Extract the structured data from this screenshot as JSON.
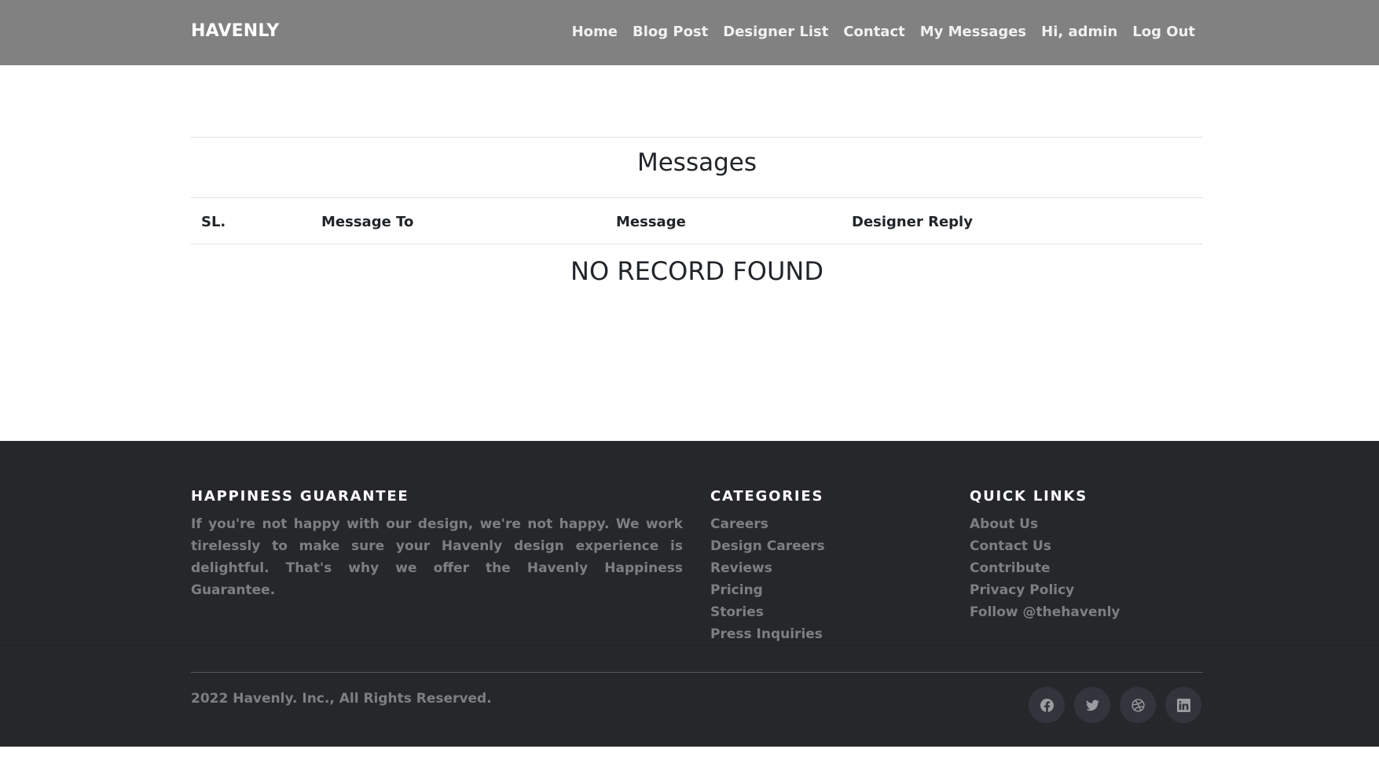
{
  "header": {
    "brand": "HAVENLY",
    "nav": [
      {
        "label": "Home"
      },
      {
        "label": "Blog Post"
      },
      {
        "label": "Designer List"
      },
      {
        "label": "Contact"
      },
      {
        "label": "My Messages"
      },
      {
        "label": "Hi, admin"
      },
      {
        "label": "Log Out"
      }
    ]
  },
  "main": {
    "title": "Messages",
    "columns": [
      "SL.",
      "Message To",
      "Message",
      "Designer Reply"
    ],
    "empty_text": "NO RECORD FOUND"
  },
  "footer": {
    "about": {
      "heading": "HAPPINESS GUARANTEE",
      "text": "If you're not happy with our design, we're not happy. We work tirelessly to make sure your Havenly design experience is delightful. That's why we offer the Havenly Happiness Guarantee."
    },
    "categories": {
      "heading": "CATEGORIES",
      "items": [
        "Careers",
        "Design Careers",
        "Reviews",
        "Pricing",
        "Stories",
        "Press Inquiries"
      ]
    },
    "quick_links": {
      "heading": "QUICK LINKS",
      "items": [
        "About Us",
        "Contact Us",
        "Contribute",
        "Privacy Policy",
        "Follow @thehavenly"
      ]
    },
    "copyright": "2022 Havenly. Inc., All Rights Reserved.",
    "social": [
      "facebook-icon",
      "twitter-icon",
      "dribbble-icon",
      "linkedin-icon"
    ]
  },
  "colors": {
    "navbar_bg": "#818181",
    "footer_bg": "#26272b",
    "footer_text": "#7d7f83",
    "social_bg": "#33353d"
  }
}
